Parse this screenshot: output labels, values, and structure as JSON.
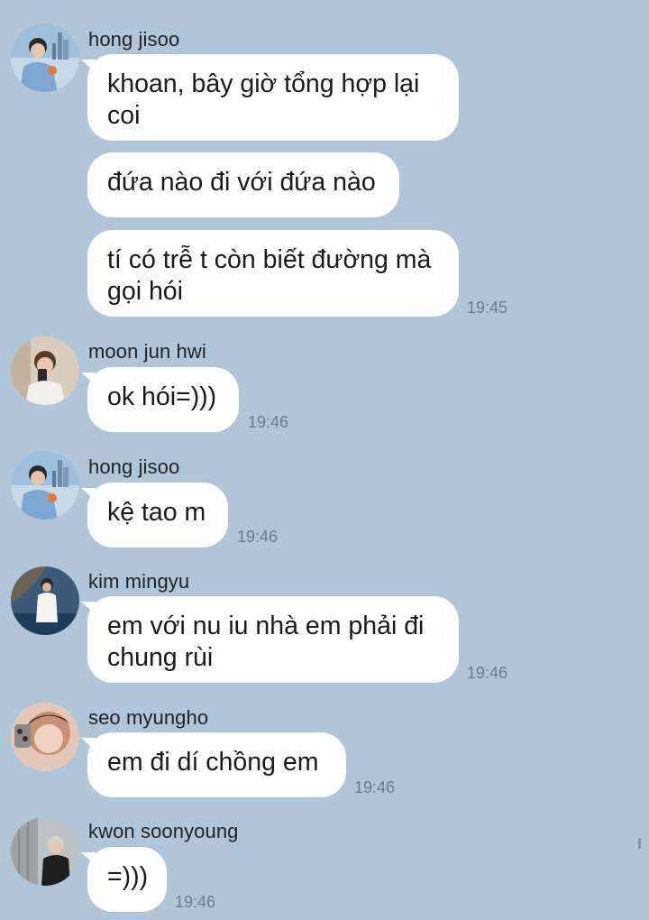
{
  "messages": [
    {
      "sender": "hong jisoo",
      "bubbles": [
        "khoan, bây giờ tổng hợp lại coi",
        "đứa nào đi với đứa nào",
        "tí có trễ t còn biết đường mà gọi hói"
      ],
      "time": "19:45"
    },
    {
      "sender": "moon jun hwi",
      "bubbles": [
        "ok hói=)))"
      ],
      "time": "19:46"
    },
    {
      "sender": "hong jisoo",
      "bubbles": [
        "kệ tao m"
      ],
      "time": "19:46"
    },
    {
      "sender": "kim mingyu",
      "bubbles": [
        "em với nu iu nhà em phải đi chung rùi"
      ],
      "time": "19:46"
    },
    {
      "sender": "seo myungho",
      "bubbles": [
        "em đi dí chồng em"
      ],
      "time": "19:46"
    },
    {
      "sender": "kwon soonyoung",
      "bubbles": [
        "=)))"
      ],
      "time": "19:46"
    }
  ],
  "colors": {
    "background": "#b1c5d9",
    "bubble": "#ffffff",
    "timestamp": "#6d7b89"
  }
}
